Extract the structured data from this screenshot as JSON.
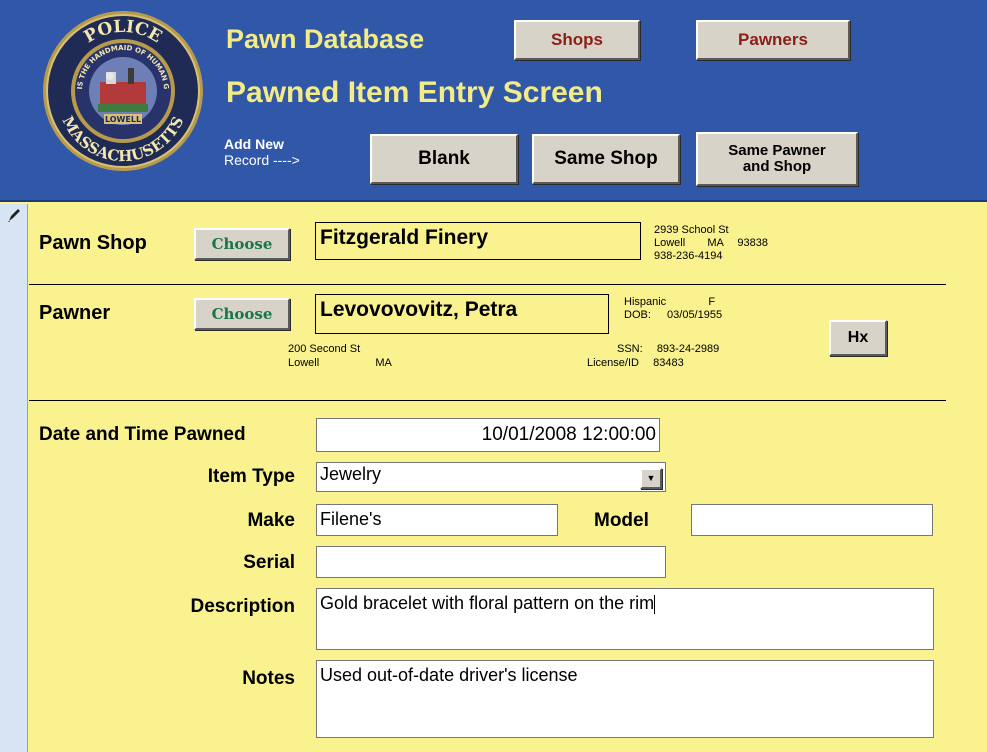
{
  "header": {
    "seal": {
      "top_text": "POLICE",
      "motto": "ART IS THE HANDMAID OF HUMAN GOOD",
      "city": "LOWELL",
      "bottom_text": "MASSACHUSETTS"
    },
    "title": "Pawn Database",
    "subtitle": "Pawned Item Entry Screen",
    "shops_label": "Shops",
    "pawners_label": "Pawners",
    "add_new_line1": "Add New",
    "add_new_line2": "Record ---->",
    "blank_label": "Blank",
    "same_shop_label": "Same Shop",
    "same_pawner_line1": "Same Pawner",
    "same_pawner_line2": "and Shop"
  },
  "record_selector": {
    "icon": "pencil-icon"
  },
  "pawn_shop": {
    "label": "Pawn Shop",
    "choose_label": "Choose",
    "name": "Fitzgerald Finery",
    "street": "2939 School St",
    "city": "Lowell",
    "state": "MA",
    "zip": "93838",
    "phone": "938-236-4194"
  },
  "pawner": {
    "label": "Pawner",
    "choose_label": "Choose",
    "name": "Levovovovitz, Petra",
    "ethnicity": "Hispanic",
    "sex": "F",
    "dob_label": "DOB:",
    "dob": "03/05/1955",
    "ssn_label": "SSN:",
    "ssn": "893-24-2989",
    "license_label": "License/ID",
    "license": "83483",
    "street": "200 Second St",
    "city": "Lowell",
    "state": "MA",
    "hx_label": "Hx"
  },
  "item": {
    "date_label": "Date and Time Pawned",
    "date_value": "10/01/2008 12:00:00",
    "type_label": "Item Type",
    "type_value": "Jewelry",
    "make_label": "Make",
    "make_value": "Filene's",
    "model_label": "Model",
    "model_value": "",
    "serial_label": "Serial",
    "serial_value": "",
    "description_label": "Description",
    "description_value": "Gold bracelet with floral pattern on the rim",
    "notes_label": "Notes",
    "notes_value": "Used out-of-date driver's license"
  },
  "colors": {
    "header_bg": "#3158a8",
    "header_text": "#f3ec86",
    "form_bg": "#f9f28f",
    "nav_button_text": "#8b1f16",
    "choose_text": "#16774a"
  }
}
